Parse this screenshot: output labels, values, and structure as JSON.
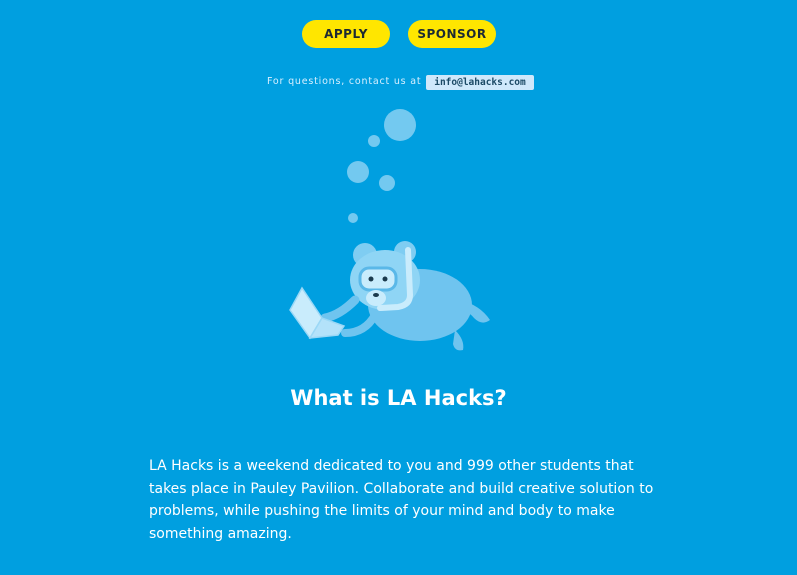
{
  "buttons": {
    "apply_label": "APPLY",
    "sponsor_label": "SPONSOR"
  },
  "contact": {
    "text": "For questions, contact us at",
    "email": "info@lahacks.com"
  },
  "about": {
    "heading": "What is LA Hacks?",
    "body": "LA Hacks is a weekend dedicated to you and 999 other students that takes place in Pauley Pavilion. Collaborate and build creative solution to problems, while pushing the limits of your mind and body to make something amazing."
  },
  "colors": {
    "background": "#009fe0",
    "button": "#ffe600",
    "bear": "#7fcdf2"
  },
  "illustration": {
    "icon": "snorkel-bear-with-laptop-icon"
  }
}
